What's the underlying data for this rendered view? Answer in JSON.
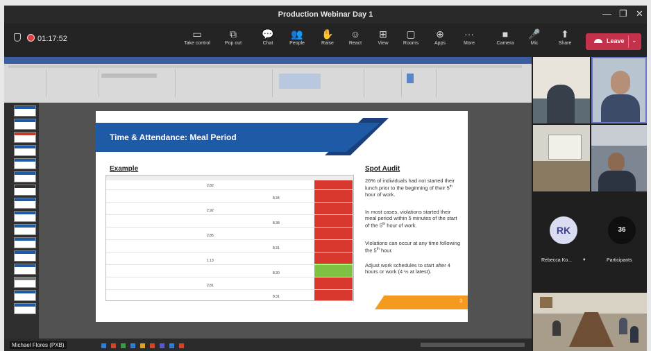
{
  "window": {
    "title": "Production Webinar Day 1",
    "minimize": "—",
    "restore": "❐",
    "close": "✕"
  },
  "meeting": {
    "timer": "01:17:52",
    "toolbar": [
      {
        "label": "Take control",
        "icon": "▭"
      },
      {
        "label": "Pop out",
        "icon": "⧉"
      },
      {
        "label": "Chat",
        "icon": "💬"
      },
      {
        "label": "People",
        "icon": "👥"
      },
      {
        "label": "Raise",
        "icon": "✋"
      },
      {
        "label": "React",
        "icon": "☺"
      },
      {
        "label": "View",
        "icon": "⊞"
      },
      {
        "label": "Rooms",
        "icon": "▢"
      },
      {
        "label": "Apps",
        "icon": "⊕"
      },
      {
        "label": "More",
        "icon": "···"
      },
      {
        "label": "Camera",
        "icon": "■"
      },
      {
        "label": "Mic",
        "icon": "🎤"
      },
      {
        "label": "Share",
        "icon": "⬆"
      }
    ],
    "leave_label": "Leave",
    "leave_color": "#c4314b"
  },
  "slide": {
    "title": "Time & Attendance:  Meal Period",
    "example_heading": "Example",
    "audit_heading": "Spot Audit",
    "numbers": [
      "2.82",
      "8.34",
      "2.92",
      "8.38",
      "2.85",
      "8.31",
      "1.13",
      "8.30",
      "2.81",
      "8.31"
    ],
    "page_number": "3"
  },
  "presenter_name": "Michael Flores (PXB)",
  "participants": {
    "rk_initials": "RK",
    "rk_name": "Rebecca Ko...",
    "count": "36",
    "count_label": "Participants"
  },
  "colors": {
    "accent_blue": "#1f5aa6",
    "alert_red": "#d9382f",
    "ok_green": "#7dc242",
    "orange": "#f39a1f"
  }
}
